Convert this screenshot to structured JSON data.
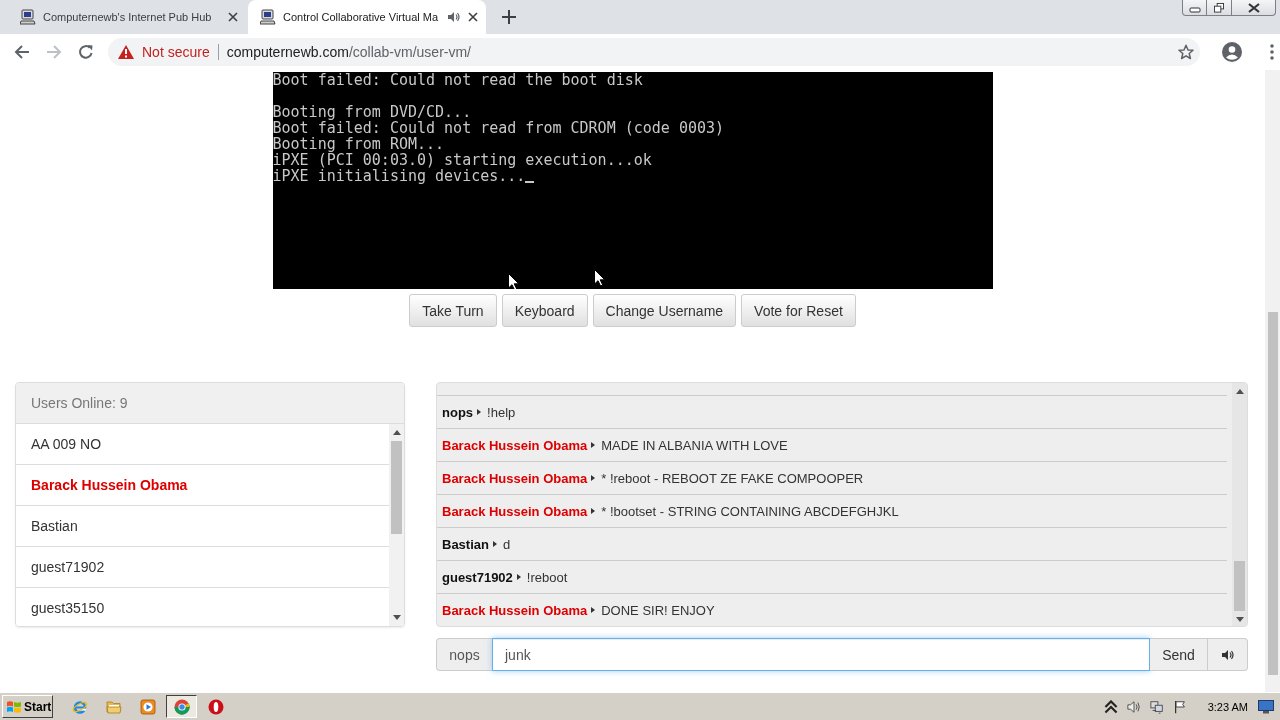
{
  "browser": {
    "tabs": [
      {
        "title": "Computernewb's Internet Pub Hub",
        "selected": false,
        "audio": false
      },
      {
        "title": "Control Collaborative Virtual Ma",
        "selected": true,
        "audio": true
      }
    ],
    "back": {
      "disabled": false
    },
    "forward": {
      "disabled": true
    },
    "address": {
      "security": "Not secure",
      "host": "computernewb.com",
      "path": "/collab-vm/user-vm/"
    }
  },
  "vm_screen": {
    "blocks": [
      {
        "lines": [
          "Boot failed: Could not read the boot disk"
        ]
      },
      {
        "lines": [
          "Booting from DVD/CD...",
          "Boot failed: Could not read from CDROM (code 0003)",
          "Booting from ROM...",
          "iPXE (PCI 00:03.0) starting execution...ok",
          "iPXE initialising devices..."
        ]
      }
    ],
    "cursor": true
  },
  "vm_buttons": [
    "Take Turn",
    "Keyboard",
    "Change Username",
    "Vote for Reset"
  ],
  "users_panel": {
    "header": "Users Online: 9",
    "users": [
      {
        "name": "AA 009 NO",
        "kind": "user"
      },
      {
        "name": "Barack Hussein Obama",
        "kind": "admin"
      },
      {
        "name": "Bastian",
        "kind": "user"
      },
      {
        "name": "guest71902",
        "kind": "user"
      },
      {
        "name": "guest35150",
        "kind": "user"
      }
    ]
  },
  "chat": {
    "messages": [
      {
        "user": "nops",
        "kind": "user",
        "text": "!help"
      },
      {
        "user": "Barack Hussein Obama",
        "kind": "admin",
        "text": "MADE IN ALBANIA WITH LOVE"
      },
      {
        "user": "Barack Hussein Obama",
        "kind": "admin",
        "text": "* !reboot - REBOOT ZE FAKE COMPOOPER"
      },
      {
        "user": "Barack Hussein Obama",
        "kind": "admin",
        "text": "* !bootset - STRING CONTAINING ABCDEFGHJKL"
      },
      {
        "user": "Bastian",
        "kind": "user",
        "text": "d"
      },
      {
        "user": "guest71902",
        "kind": "user",
        "text": "!reboot"
      },
      {
        "user": "Barack Hussein Obama",
        "kind": "admin",
        "text": "DONE SIR! ENJOY"
      }
    ]
  },
  "chat_input": {
    "username": "nops",
    "value": "junk",
    "focused": true,
    "send": "Send"
  },
  "taskbar": {
    "start": "Start",
    "apps": [
      {
        "kind": "letter",
        "selected": false
      },
      {
        "kind": "folder",
        "selected": false
      },
      {
        "kind": "player",
        "selected": false
      },
      {
        "kind": "wheel",
        "selected": true
      },
      {
        "kind": "ring",
        "selected": false
      }
    ],
    "clock": "3:23 AM"
  }
}
